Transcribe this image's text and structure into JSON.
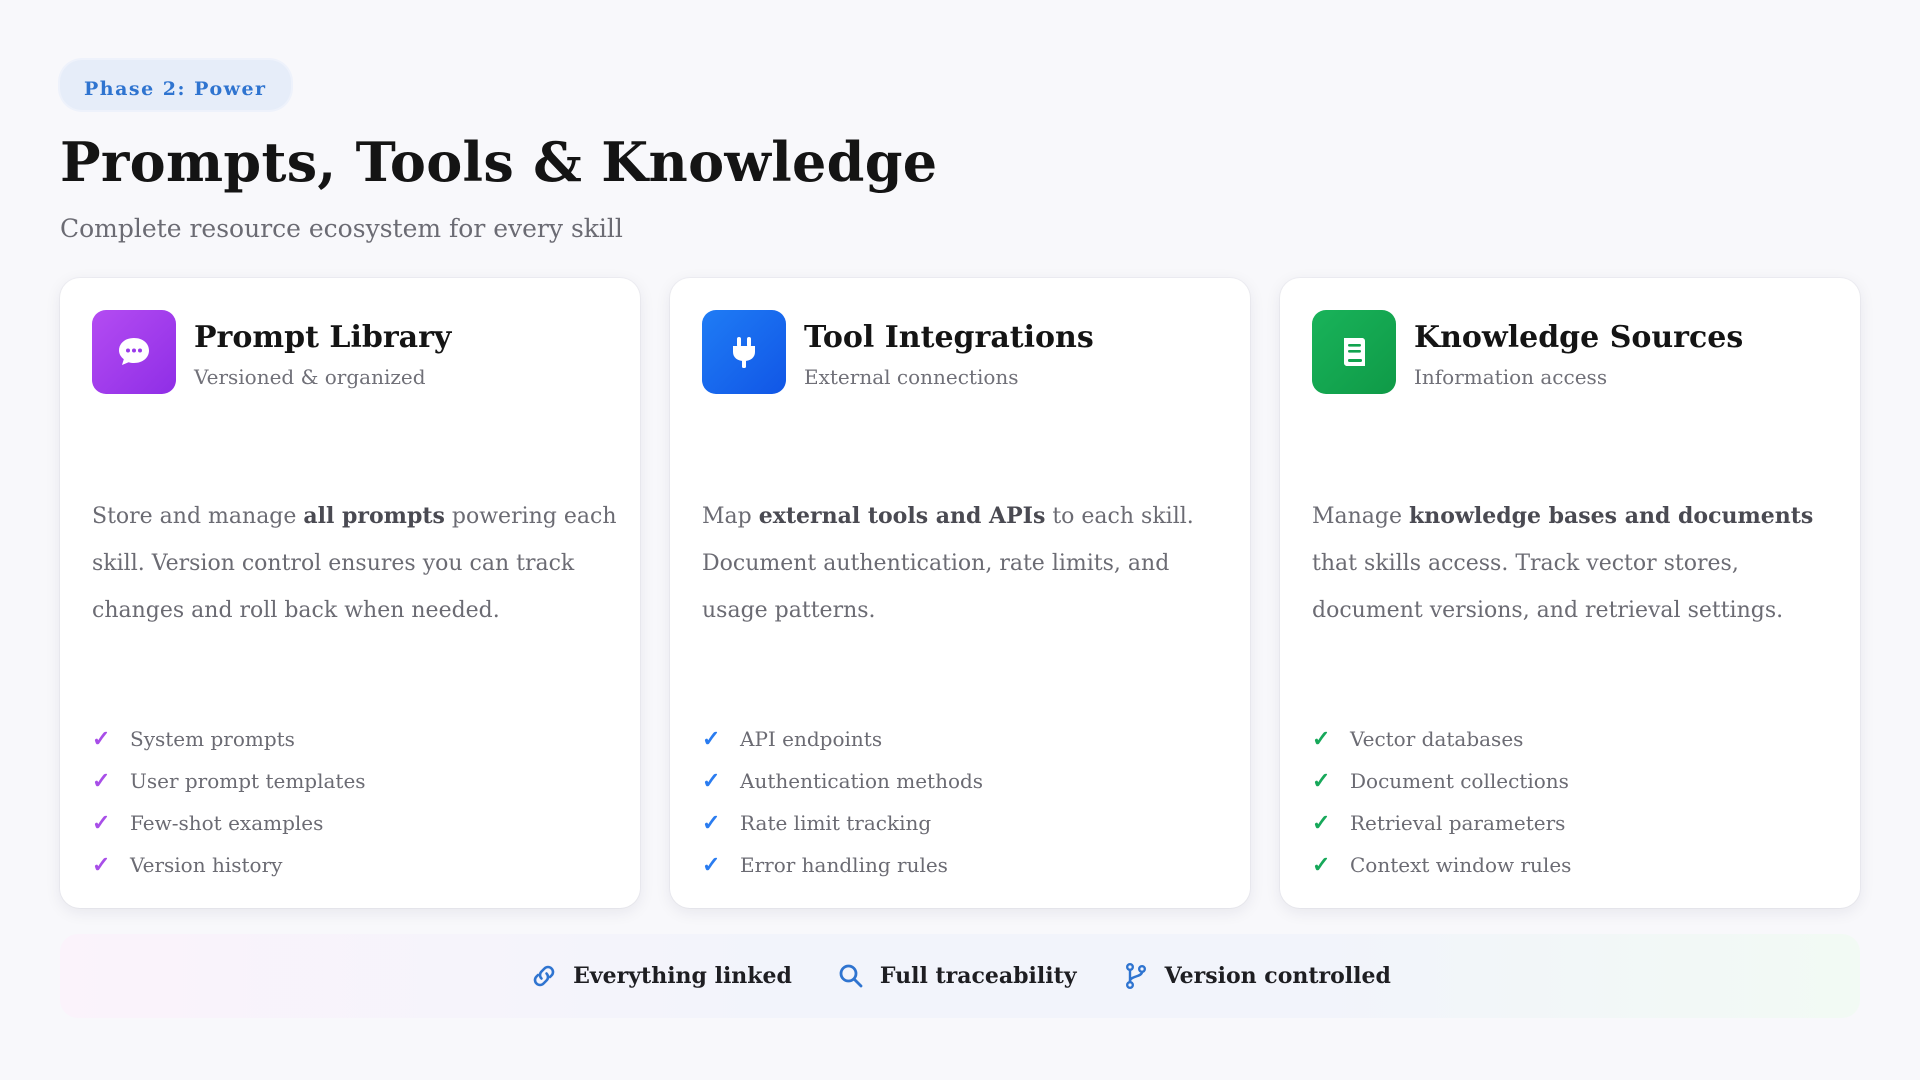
{
  "header": {
    "phase_label": "Phase 2: Power",
    "title": "Prompts, Tools & Knowledge",
    "subtitle": "Complete resource ecosystem for every skill"
  },
  "colors": {
    "accent_blue": "#2f74d0",
    "purple": "#a84ee8",
    "blue": "#1f7cf5",
    "green": "#17a85a"
  },
  "cards": [
    {
      "icon": "chat-bubble-icon",
      "title": "Prompt Library",
      "subtitle": "Versioned & organized",
      "desc_pre": "Store and manage ",
      "desc_bold": "all prompts",
      "desc_post": " powering each skill. Version control ensures you can track changes and roll back when needed.",
      "features": [
        "System prompts",
        "User prompt templates",
        "Few-shot examples",
        "Version history"
      ]
    },
    {
      "icon": "plug-icon",
      "title": "Tool Integrations",
      "subtitle": "External connections",
      "desc_pre": "Map ",
      "desc_bold": "external tools and APIs",
      "desc_post": " to each skill. Document authentication, rate limits, and usage patterns.",
      "features": [
        "API endpoints",
        "Authentication methods",
        "Rate limit tracking",
        "Error handling rules"
      ]
    },
    {
      "icon": "book-icon",
      "title": "Knowledge Sources",
      "subtitle": "Information access",
      "desc_pre": "Manage ",
      "desc_bold": "knowledge bases and documents",
      "desc_post": " that skills access. Track vector stores, document versions, and retrieval settings.",
      "features": [
        "Vector databases",
        "Document collections",
        "Retrieval parameters",
        "Context window rules"
      ]
    }
  ],
  "footer": {
    "items": [
      {
        "icon": "link-icon",
        "label": "Everything linked"
      },
      {
        "icon": "search-icon",
        "label": "Full traceability"
      },
      {
        "icon": "branch-icon",
        "label": "Version controlled"
      }
    ]
  }
}
